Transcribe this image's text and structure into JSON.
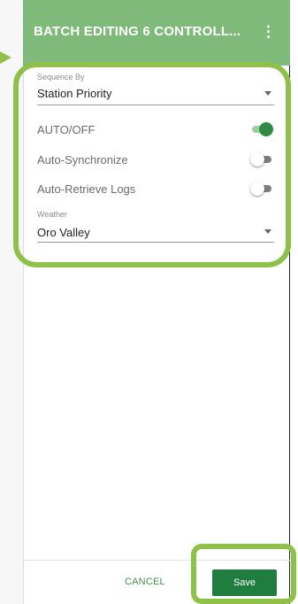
{
  "header": {
    "title": "BATCH EDITING 6 CONTROLL...",
    "menu_icon": "kebab-menu-icon"
  },
  "form": {
    "sequence_by": {
      "label": "Sequence By",
      "value": "Station Priority"
    },
    "toggles": [
      {
        "label": "AUTO/OFF",
        "on": true
      },
      {
        "label": "Auto-Synchronize",
        "on": false
      },
      {
        "label": "Auto-Retrieve Logs",
        "on": false
      }
    ],
    "weather": {
      "label": "Weather",
      "value": "Oro Valley"
    }
  },
  "footer": {
    "cancel_label": "CANCEL",
    "save_label": "Save"
  },
  "colors": {
    "header": "#7fba7a",
    "highlight": "#8fc14a",
    "save_button": "#1f7d3f",
    "toggle_on": "#2f8a43"
  }
}
